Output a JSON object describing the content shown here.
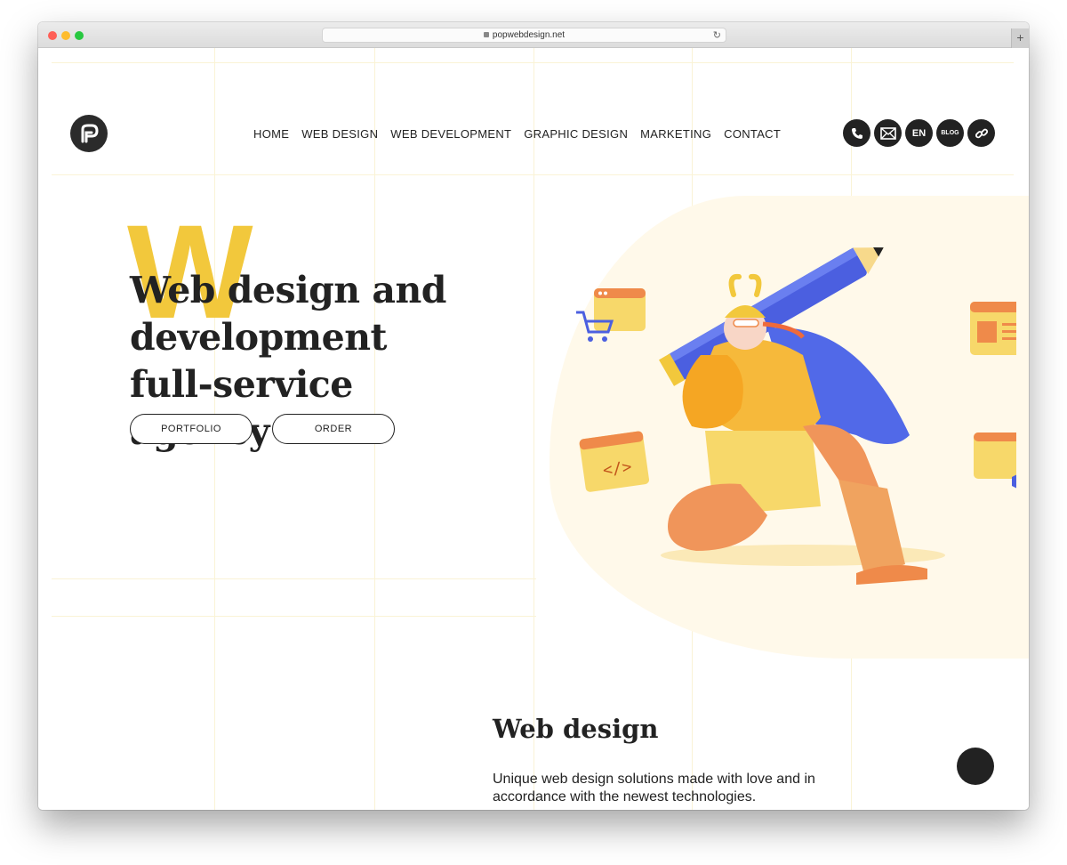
{
  "browser": {
    "url": "popwebdesign.net",
    "new_tab_label": "+"
  },
  "header": {
    "nav": [
      "HOME",
      "WEB DESIGN",
      "WEB DEVELOPMENT",
      "GRAPHIC DESIGN",
      "MARKETING",
      "CONTACT"
    ],
    "icons": {
      "phone": "phone-icon",
      "mail": "mail-icon",
      "lang_label": "EN",
      "blog_label": "BLOG",
      "link": "link-icon"
    }
  },
  "hero": {
    "decor_letter": "W",
    "headline_lines": [
      "Web design and",
      "development",
      "full-service agency"
    ],
    "buttons": {
      "portfolio": "PORTFOLIO",
      "order": "ORDER"
    }
  },
  "section": {
    "title": "Web design",
    "text": "Unique web design solutions made with love and in accordance with the newest technologies."
  },
  "colors": {
    "accent_yellow": "#f2c83c",
    "dark": "#222222",
    "blob": "#fff9ea",
    "blue": "#5169e8",
    "orange": "#ef8a4a"
  }
}
